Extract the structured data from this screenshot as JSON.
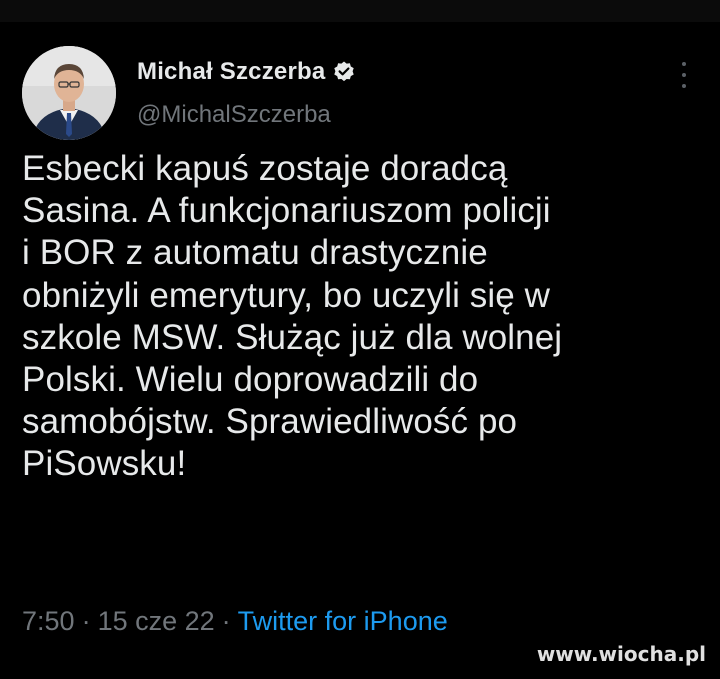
{
  "author": {
    "display_name": "Michał Szczerba",
    "handle": "@MichalSzczerba",
    "verified": true
  },
  "tweet": {
    "text": "Esbecki kapuś zostaje doradcą\nSasina. A funkcjonariuszom policji\ni BOR z automatu drastycznie\nobniżyli emerytury, bo uczyli się w\nszkole MSW. Służąc już dla wolnej\nPolski. Wielu doprowadzili do\nsamobójstw. Sprawiedliwość po\nPiSowsku!",
    "time": "7:50",
    "date": "15 cze 22",
    "separator": "·",
    "source": "Twitter for iPhone"
  },
  "watermark": "www.wiocha.pl",
  "colors": {
    "background": "#000000",
    "text_primary": "#e7e9ea",
    "text_secondary": "#71767b",
    "link_blue": "#1d9bf0",
    "verified_badge": "#e7e9ea"
  },
  "icons": {
    "verified": "verified-badge-icon",
    "more": "more-options-icon"
  }
}
